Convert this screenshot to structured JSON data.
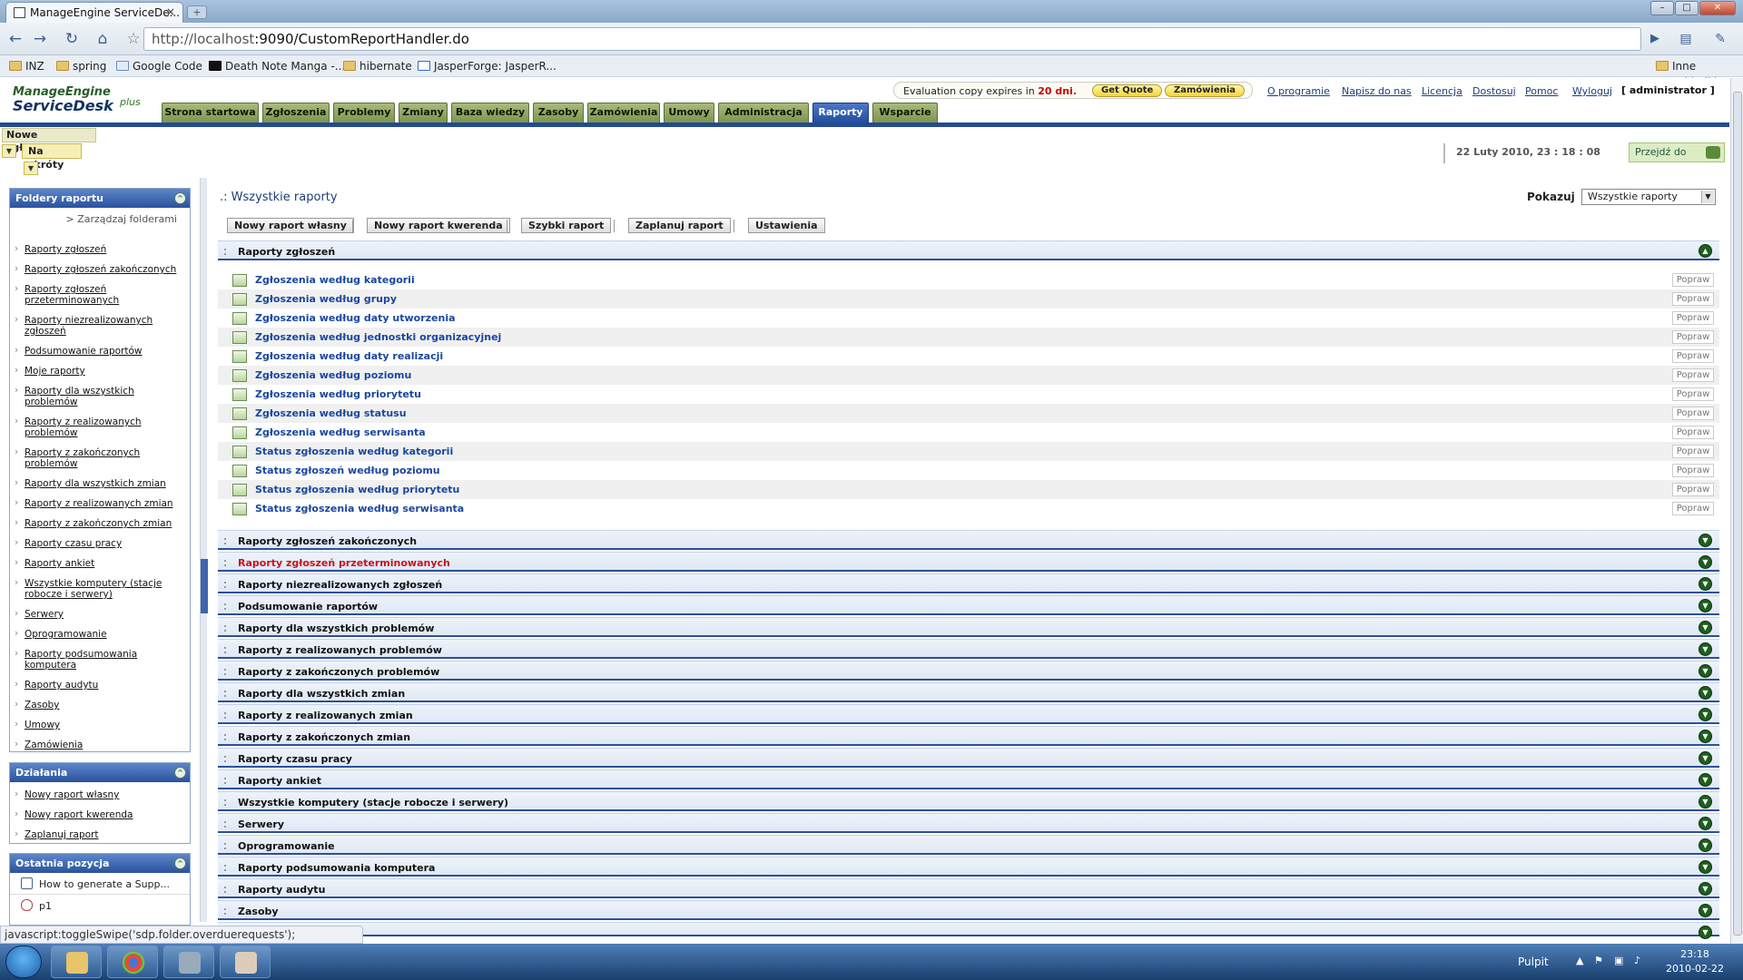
{
  "browser": {
    "tab_title": "ManageEngine ServiceDe...",
    "tab_close": "×",
    "new_tab": "+",
    "url_host": "http://localhost",
    "url_rest": ":9090/CustomReportHandler.do",
    "bookmarks": [
      "INZ",
      "spring",
      "Google Code",
      "Death Note Manga -...",
      "hibernate",
      "JasperForge: JasperR..."
    ],
    "other_bookmarks": "Inne zakładki",
    "status_text": "javascript:toggleSwipe('sdp.folder.overduerequests');"
  },
  "app": {
    "logo_top": "ManageEngine",
    "logo_main": "ServiceDesk",
    "logo_plus": "plus",
    "eval_text_a": "Evaluation copy expires in",
    "eval_days": "20 dni.",
    "get_quote": "Get Quote",
    "orders_btn": "Zamówienia",
    "top_links": [
      "O programie",
      "Napisz do nas",
      "Licencja",
      "Dostosuj",
      "Pomoc",
      "Wyloguj"
    ],
    "user": "[ administrator ]",
    "tabs": [
      "Strona startowa",
      "Zgłoszenia",
      "Problemy",
      "Zmiany",
      "Baza wiedzy",
      "Zasoby",
      "Zamówienia",
      "Umowy",
      "Administracja",
      "Raporty",
      "Wsparcie"
    ],
    "active_tab": "Raporty",
    "new_request": "Nowe zgłoszenie",
    "shortcuts": "Na skróty",
    "datetime": "22 Luty 2010, 23 : 18 : 08",
    "goto": "Przejdź do"
  },
  "sidebar": {
    "folders_title": "Foldery raportu",
    "manage_folders": "> Zarządzaj folderami",
    "folders": [
      "Raporty zgłoszeń",
      "Raporty zgłoszeń zakończonych",
      "Raporty zgłoszeń przeterminowanych",
      "Raporty niezrealizowanych zgłoszeń",
      "Podsumowanie raportów",
      "Moje raporty",
      "Raporty dla wszystkich problemów",
      "Raporty z realizowanych problemów",
      "Raporty z zakończonych problemów",
      "Raporty dla wszystkich zmian",
      "Raporty z realizowanych zmian",
      "Raporty z zakończonych zmian",
      "Raporty czasu pracy",
      "Raporty ankiet",
      "Wszystkie komputery (stacje robocze i serwery)",
      "Serwery",
      "Oprogramowanie",
      "Raporty podsumowania komputera",
      "Raporty audytu",
      "Zasoby",
      "Umowy",
      "Zamówienia"
    ],
    "actions_title": "Działania",
    "actions": [
      "Nowy raport własny",
      "Nowy raport kwerenda",
      "Zaplanuj raport"
    ],
    "recent_title": "Ostatnia pozycja",
    "recent": [
      "How to generate a Supp...",
      "p1"
    ]
  },
  "main": {
    "title": ".: Wszystkie raporty",
    "show_label": "Pokazuj",
    "show_value": "Wszystkie raporty",
    "action_buttons": [
      "Nowy raport własny",
      "Nowy raport kwerenda",
      "Szybki raport",
      "Zaplanuj raport",
      "Ustawienia"
    ],
    "open_section": "Raporty zgłoszeń",
    "edit_label": "Popraw",
    "reports": [
      "Zgłoszenia według kategorii",
      "Zgłoszenia według grupy",
      "Zgłoszenia według daty utworzenia",
      "Zgłoszenia według jednostki organizacyjnej",
      "Zgłoszenia według daty realizacji",
      "Zgłoszenia według poziomu",
      "Zgłoszenia według priorytetu",
      "Zgłoszenia według statusu",
      "Zgłoszenia według serwisanta",
      "Status zgłoszenia według kategorii",
      "Status zgłoszeń według poziomu",
      "Status zgłoszenia według priorytetu",
      "Status zgłoszenia według serwisanta"
    ],
    "sections": [
      "Raporty zgłoszeń zakończonych",
      "Raporty zgłoszeń przeterminowanych",
      "Raporty niezrealizowanych zgłoszeń",
      "Podsumowanie raportów",
      "Raporty dla wszystkich problemów",
      "Raporty z realizowanych problemów",
      "Raporty z zakończonych problemów",
      "Raporty dla wszystkich zmian",
      "Raporty z realizowanych zmian",
      "Raporty z zakończonych zmian",
      "Raporty czasu pracy",
      "Raporty ankiet",
      "Wszystkie komputery (stacje robocze i serwery)",
      "Serwery",
      "Oprogramowanie",
      "Raporty podsumowania komputera",
      "Raporty audytu",
      "Zasoby"
    ],
    "highlighted_section": "Raporty zgłoszeń przeterminowanych"
  },
  "taskbar": {
    "desktop_label": "Pulpit",
    "time": "23:18",
    "date": "2010-02-22"
  },
  "colors": {
    "nav_active": "#244e9d",
    "highlight_red": "#c4161c",
    "link_blue": "#1a47a0"
  }
}
